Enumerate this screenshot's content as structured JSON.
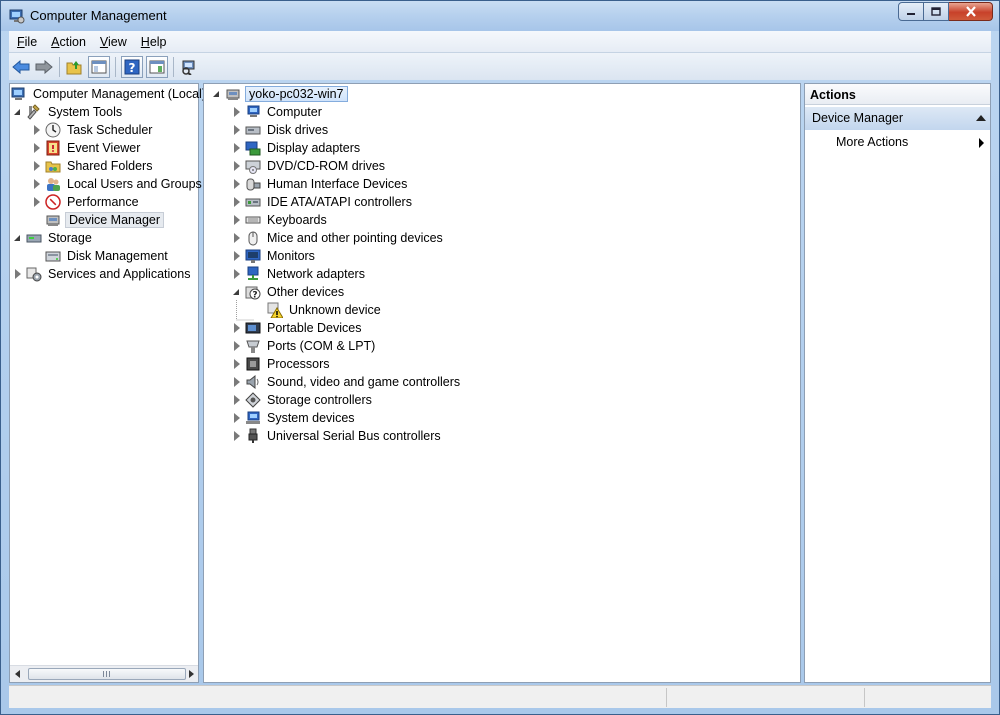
{
  "window": {
    "title": "Computer Management",
    "icon": "computer-management-icon"
  },
  "menu": {
    "items": [
      {
        "key": "F",
        "rest": "ile"
      },
      {
        "key": "A",
        "rest": "ction"
      },
      {
        "key": "V",
        "rest": "iew"
      },
      {
        "key": "H",
        "rest": "elp"
      }
    ]
  },
  "toolbar": {
    "buttons": [
      "back-icon",
      "forward-icon",
      "up-folder-icon",
      "show-hide-console-tree-icon",
      "help-icon",
      "show-hide-action-pane-icon",
      "scan-hardware-icon"
    ]
  },
  "left_tree": {
    "root": "Computer Management (Local)",
    "system_tools": "System Tools",
    "task_scheduler": "Task Scheduler",
    "event_viewer": "Event Viewer",
    "shared_folders": "Shared Folders",
    "local_users": "Local Users and Groups",
    "performance": "Performance",
    "device_manager": "Device Manager",
    "storage": "Storage",
    "disk_management": "Disk Management",
    "services": "Services and Applications"
  },
  "device_tree": {
    "root": "yoko-pc032-win7",
    "computer": "Computer",
    "disk_drives": "Disk drives",
    "display_adapters": "Display adapters",
    "dvd": "DVD/CD-ROM drives",
    "hid": "Human Interface Devices",
    "ide": "IDE ATA/ATAPI controllers",
    "keyboards": "Keyboards",
    "mice": "Mice and other pointing devices",
    "monitors": "Monitors",
    "network": "Network adapters",
    "other": "Other devices",
    "unknown": "Unknown device",
    "portable": "Portable Devices",
    "ports": "Ports (COM & LPT)",
    "processors": "Processors",
    "sound": "Sound, video and game controllers",
    "storage_ctrl": "Storage controllers",
    "system_devices": "System devices",
    "usb": "Universal Serial Bus controllers"
  },
  "actions": {
    "header": "Actions",
    "section": "Device Manager",
    "more": "More Actions"
  },
  "colors": {
    "title_gradient_top": "#c9ddf3",
    "close_red": "#c8412a",
    "selection_blue": "#cfe3fb"
  }
}
